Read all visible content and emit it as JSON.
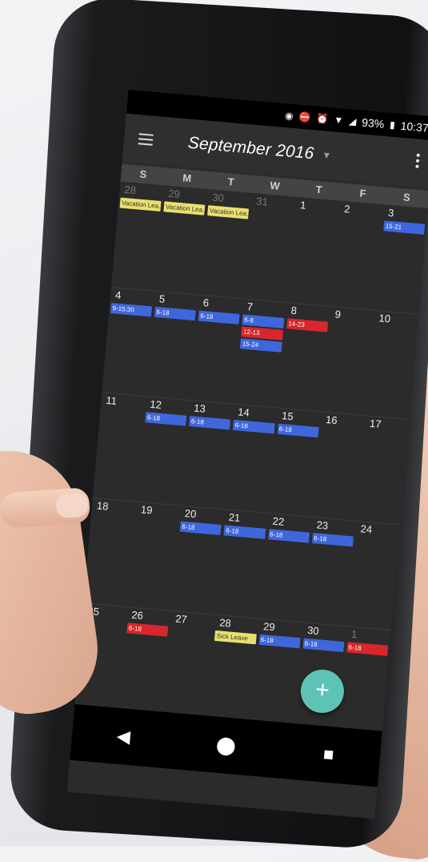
{
  "status": {
    "battery": "93%",
    "time": "10:37",
    "icons": [
      "location-icon",
      "dnd-icon",
      "alarm-icon",
      "wifi-icon",
      "signal-icon",
      "battery-icon"
    ]
  },
  "appbar": {
    "title": "September 2016"
  },
  "weekdays": [
    "S",
    "M",
    "T",
    "W",
    "T",
    "F",
    "S"
  ],
  "weeks": [
    {
      "days": [
        "28",
        "29",
        "30",
        "31",
        "1",
        "2",
        "3"
      ],
      "events": [
        {
          "col": 0,
          "text": "Vacation Lea..",
          "color": "yellow",
          "slot": 0
        },
        {
          "col": 1,
          "text": "Vacation Lea..",
          "color": "yellow",
          "slot": 0
        },
        {
          "col": 2,
          "text": "Vacation Lea..",
          "color": "yellow",
          "slot": 0
        },
        {
          "col": 6,
          "text": "15-21",
          "color": "blue",
          "slot": 0
        }
      ]
    },
    {
      "days": [
        "4",
        "5",
        "6",
        "7",
        "8",
        "9",
        "10"
      ],
      "events": [
        {
          "col": 0,
          "text": "9-15:30",
          "color": "blue",
          "slot": 0
        },
        {
          "col": 1,
          "text": "6-18",
          "color": "blue",
          "slot": 0
        },
        {
          "col": 2,
          "text": "6-18",
          "color": "blue",
          "slot": 0
        },
        {
          "col": 3,
          "text": "6-8",
          "color": "blue",
          "slot": 0
        },
        {
          "col": 4,
          "text": "14-23",
          "color": "red",
          "slot": 0
        },
        {
          "col": 3,
          "text": "12-13",
          "color": "red",
          "slot": 1
        },
        {
          "col": 3,
          "text": "15-24",
          "color": "blue",
          "slot": 2
        }
      ]
    },
    {
      "days": [
        "11",
        "12",
        "13",
        "14",
        "15",
        "16",
        "17"
      ],
      "events": [
        {
          "col": 1,
          "text": "6-18",
          "color": "blue",
          "slot": 0
        },
        {
          "col": 2,
          "text": "6-18",
          "color": "blue",
          "slot": 0
        },
        {
          "col": 3,
          "text": "6-18",
          "color": "blue",
          "slot": 0
        },
        {
          "col": 4,
          "text": "6-18",
          "color": "blue",
          "slot": 0
        }
      ]
    },
    {
      "days": [
        "18",
        "19",
        "20",
        "21",
        "22",
        "23",
        "24"
      ],
      "events": [
        {
          "col": 2,
          "text": "6-18",
          "color": "blue",
          "slot": 0
        },
        {
          "col": 3,
          "text": "6-18",
          "color": "blue",
          "slot": 0
        },
        {
          "col": 4,
          "text": "6-18",
          "color": "blue",
          "slot": 0
        },
        {
          "col": 5,
          "text": "6-18",
          "color": "blue",
          "slot": 0
        }
      ]
    },
    {
      "days": [
        "25",
        "26",
        "27",
        "28",
        "29",
        "30",
        "1"
      ],
      "events": [
        {
          "col": 1,
          "text": "6-18",
          "color": "red",
          "slot": 0
        },
        {
          "col": 3,
          "text": "Sick Leave",
          "color": "yellow",
          "slot": 0
        },
        {
          "col": 4,
          "text": "6-18",
          "color": "blue",
          "slot": 0
        },
        {
          "col": 5,
          "text": "6-18",
          "color": "blue",
          "slot": 0
        },
        {
          "col": 6,
          "text": "6-18",
          "color": "red",
          "slot": 0
        }
      ]
    }
  ],
  "muted_days": {
    "0": [
      0,
      1,
      2,
      3
    ],
    "4": [
      6
    ]
  },
  "fab": {
    "label": "+"
  }
}
